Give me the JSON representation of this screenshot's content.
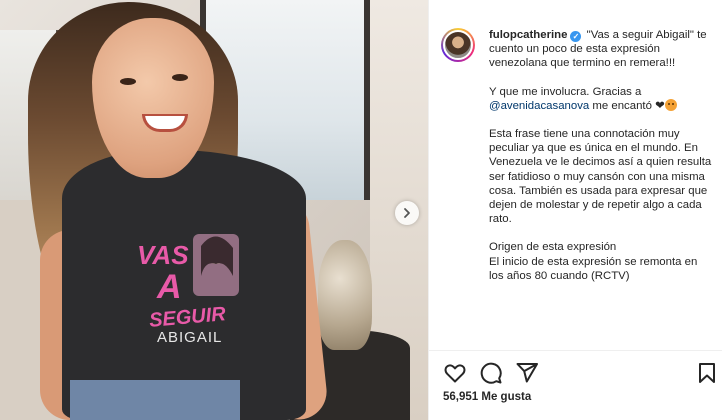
{
  "post": {
    "username": "fulopcatherine",
    "caption": {
      "intro": "\"Vas a seguir Abigail\" te cuento un poco de esta expresión venezolana que termino en remera!!!",
      "p2_before": "Y que me involucra. Gracias a ",
      "p2_mention": "@avenidacasanova",
      "p2_after": " me encantó ❤",
      "p3": "Esta frase tiene una connotación muy peculiar ya que es única en el mundo. En Venezuela ve le decimos así a quien resulta ser fatidioso o muy cansón con una misma cosa. También es usada para expresar que dejen de molestar y de repetir algo a cada rato.",
      "p4_line1": "Origen de esta expresión",
      "p4_line2": "El inicio de esta expresión se remonta en los años 80 cuando (RCTV)"
    },
    "likes_label": "56,951 Me gusta"
  },
  "shirt_print": {
    "line1": "VAS",
    "line2": "A",
    "line3": "SEGUIR",
    "line4": "ABIGAIL"
  },
  "icons": {
    "next": "chevron-right-icon",
    "like": "heart-icon",
    "comment": "comment-icon",
    "share": "send-icon",
    "save": "bookmark-icon"
  },
  "colors": {
    "verified": "#3897f0",
    "mention": "#00376b",
    "shirt_print": "#e85aa8"
  }
}
